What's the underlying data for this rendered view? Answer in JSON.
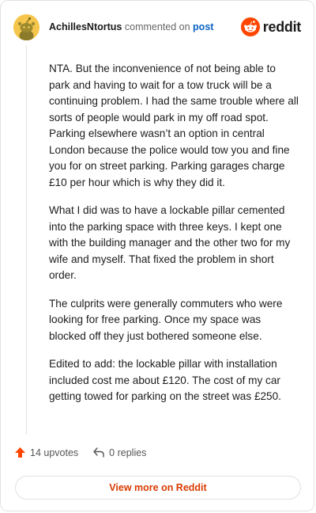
{
  "header": {
    "username": "AchillesNtortus",
    "action_text": "commented on",
    "post_link": "post",
    "brand_name": "reddit",
    "brand_color": "#ff4500",
    "avatar_icon": "snoo-avatar-icon"
  },
  "comment": {
    "paragraphs": [
      "NTA. But the inconvenience of not being able to park and having to wait for a tow truck will be a continuing problem. I had the same trouble where all sorts of people would park in my off road spot. Parking elsewhere wasn’t an option in central London because the police would tow you and fine you for on street parking. Parking garages charge £10 per hour which is why they did it.",
      "What I did was to have a lockable pillar cemented into the parking space with three keys. I kept one with the building manager and the other two for my wife and myself. That fixed the problem in short order.",
      "The culprits were generally commuters who were looking for free parking. Once my space was blocked off they just bothered someone else.",
      "Edited to add: the lockable pillar with installation included cost me about £120. The cost of my car getting towed for parking on the street was £250."
    ]
  },
  "actions": {
    "upvotes_label": "14 upvotes",
    "replies_label": "0 replies",
    "upvote_color": "#ff4500"
  },
  "footer": {
    "view_more_label": "View more on Reddit",
    "view_more_color": "#d93a00"
  }
}
